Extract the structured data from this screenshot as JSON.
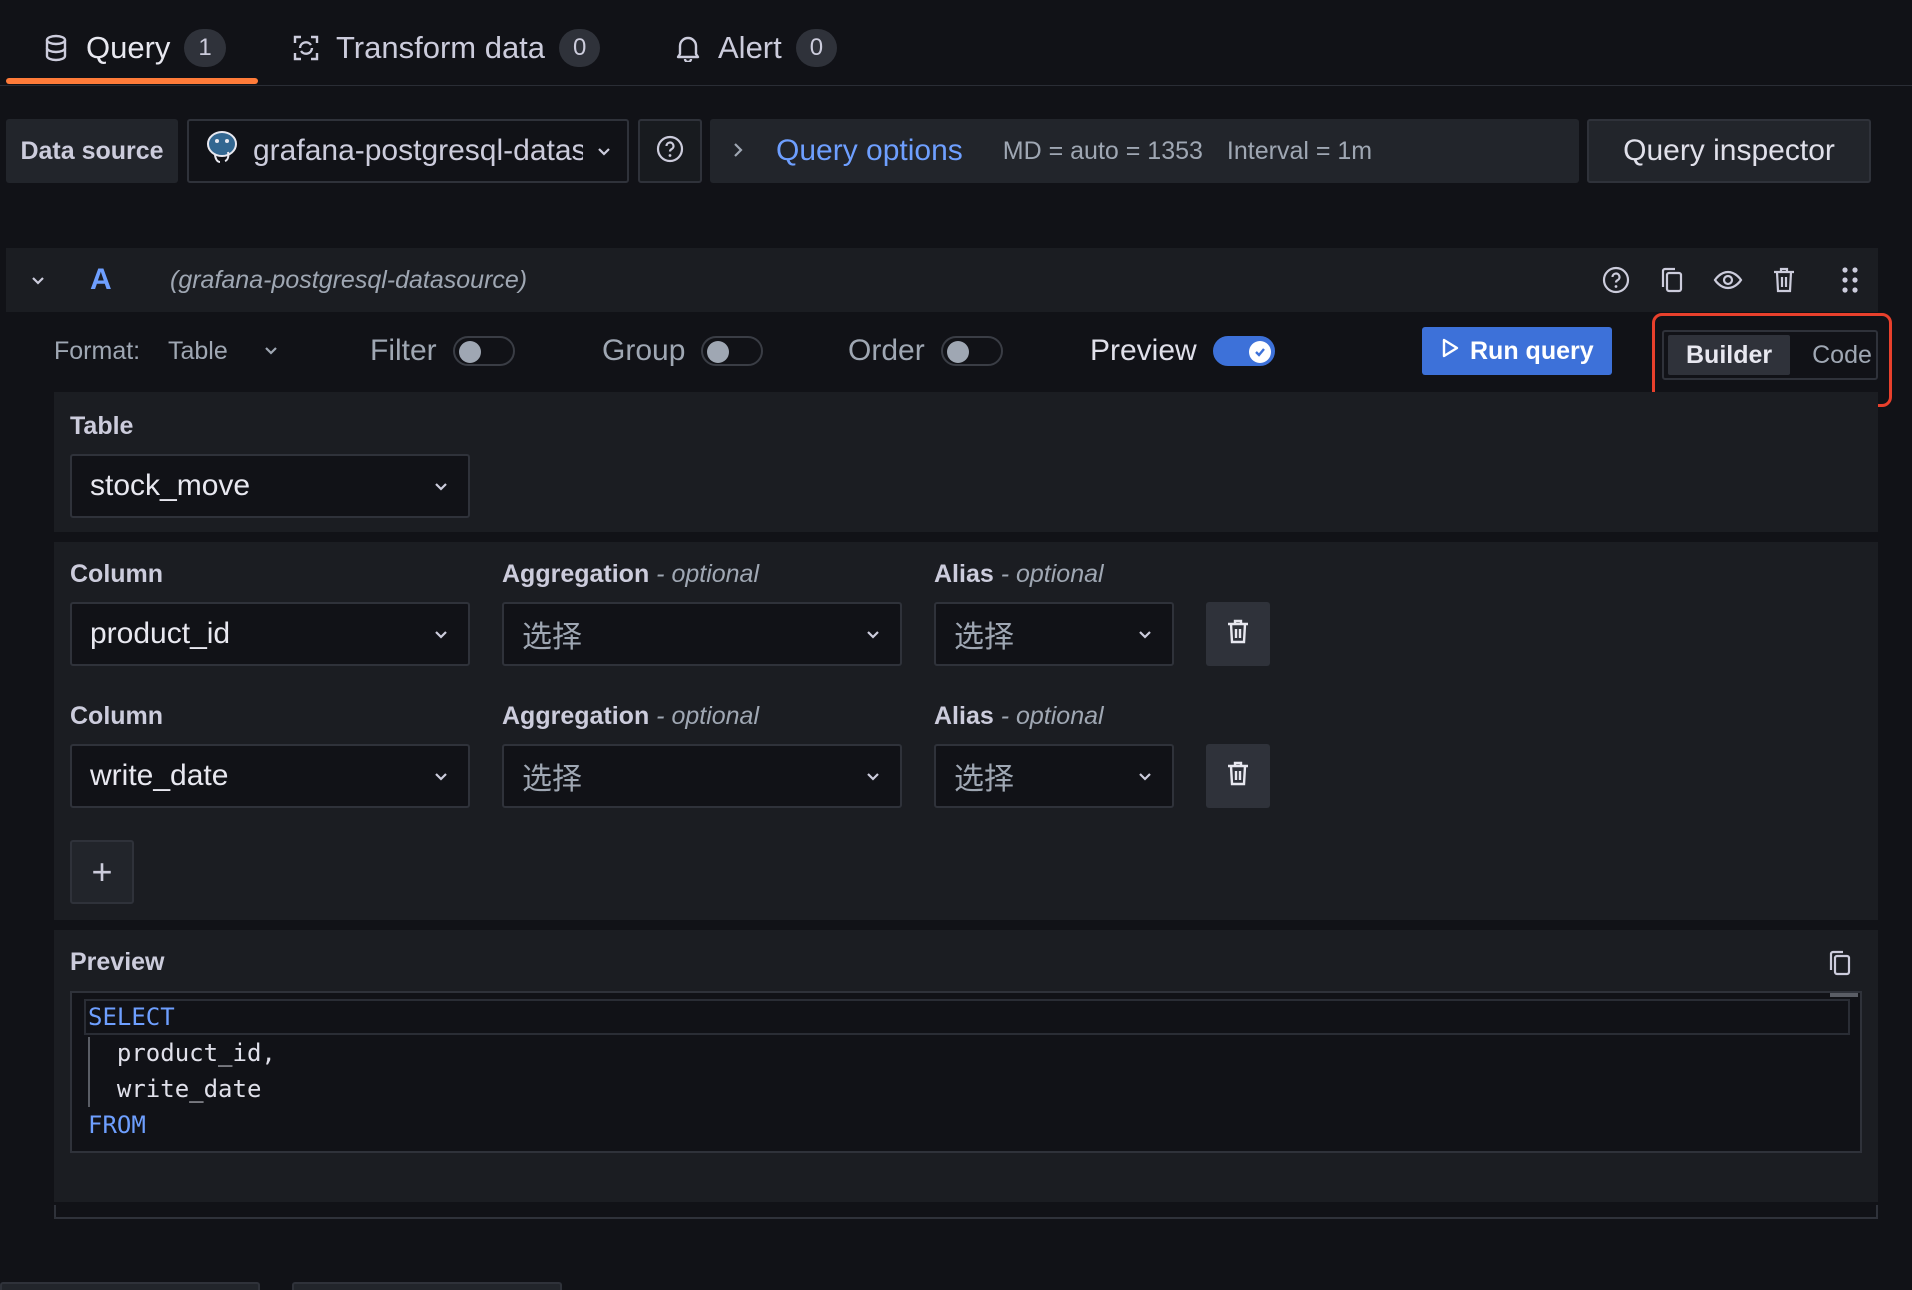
{
  "tabs": [
    {
      "label": "Query",
      "count": "1",
      "icon": "database-icon"
    },
    {
      "label": "Transform data",
      "count": "0",
      "icon": "transform-icon"
    },
    {
      "label": "Alert",
      "count": "0",
      "icon": "bell-icon"
    }
  ],
  "toolbar": {
    "datasource_label": "Data source",
    "datasource_value": "grafana-postgresql-datasource",
    "query_options_label": "Query options",
    "md_text": "MD = auto = 1353",
    "interval_text": "Interval = 1m",
    "query_inspector_label": "Query inspector"
  },
  "query": {
    "ref_id": "A",
    "datasource_name": "(grafana-postgresql-datasource)"
  },
  "options": {
    "format_label": "Format:",
    "format_value": "Table",
    "filter_label": "Filter",
    "filter_on": false,
    "group_label": "Group",
    "group_on": false,
    "order_label": "Order",
    "order_on": false,
    "preview_label": "Preview",
    "preview_on": true,
    "run_label": "Run query",
    "mode_builder": "Builder",
    "mode_code": "Code",
    "mode_selected": "Builder"
  },
  "table_section": {
    "label": "Table",
    "value": "stock_move"
  },
  "columns": [
    {
      "column_label": "Column",
      "column_value": "product_id",
      "agg_label": "Aggregation",
      "agg_optional": "- optional",
      "agg_placeholder": "选择",
      "alias_label": "Alias",
      "alias_optional": "- optional",
      "alias_placeholder": "选择"
    },
    {
      "column_label": "Column",
      "column_value": "write_date",
      "agg_label": "Aggregation",
      "agg_optional": "- optional",
      "agg_placeholder": "选择",
      "alias_label": "Alias",
      "alias_optional": "- optional",
      "alias_placeholder": "选择"
    }
  ],
  "add_label": "+",
  "preview": {
    "label": "Preview",
    "code_lines": [
      "SELECT",
      "  product_id,",
      "  write_date",
      "FROM"
    ]
  },
  "colors": {
    "accent_blue": "#3d71d9",
    "link_blue": "#6e9fff",
    "tab_underline": "#ff7b39",
    "highlight_box": "#e8402c"
  }
}
